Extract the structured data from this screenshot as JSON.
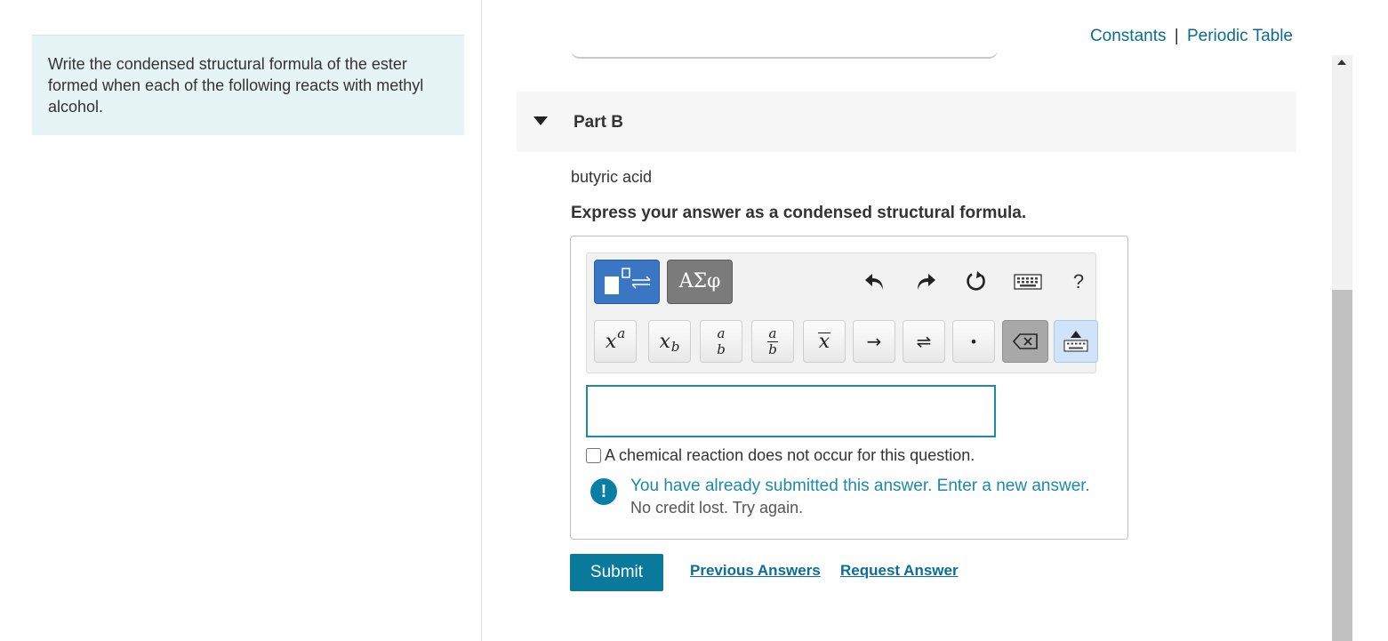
{
  "instructions": {
    "text": "Write the condensed structural formula of the ester formed when each of the following reacts with methyl alcohol."
  },
  "links": {
    "constants": "Constants",
    "separator": "|",
    "periodic_table": "Periodic Table"
  },
  "part": {
    "title": "Part B",
    "question": "butyric acid",
    "instruction": "Express your answer as a condensed structural formula."
  },
  "toolbar": {
    "greek_label": "ΑΣφ",
    "help_label": "?",
    "icons": [
      "templates-icon",
      "undo-icon",
      "redo-icon",
      "reset-icon",
      "keyboard-icon",
      "help-icon"
    ]
  },
  "keys": {
    "superscript_base": "x",
    "superscript_exp": "a",
    "subscript_base": "x",
    "subscript_sub": "b",
    "stack_top": "a",
    "stack_bottom": "b",
    "fraction_num": "a",
    "fraction_den": "b",
    "bar_label": "x",
    "arrow": "→",
    "equilibrium": "⇌",
    "dot": "•"
  },
  "answer": {
    "value": ""
  },
  "no_reaction": {
    "label": "A chemical reaction does not occur for this question.",
    "checked": false
  },
  "feedback": {
    "icon": "!",
    "message": "You have already submitted this answer. Enter a new answer.",
    "detail": "No credit lost. Try again."
  },
  "actions": {
    "submit": "Submit",
    "previous_answers": "Previous Answers",
    "request_answer": "Request Answer"
  },
  "colors": {
    "accent": "#0a7a9c",
    "link": "#0a6d8f",
    "instructions_bg": "#e6f4f5"
  }
}
